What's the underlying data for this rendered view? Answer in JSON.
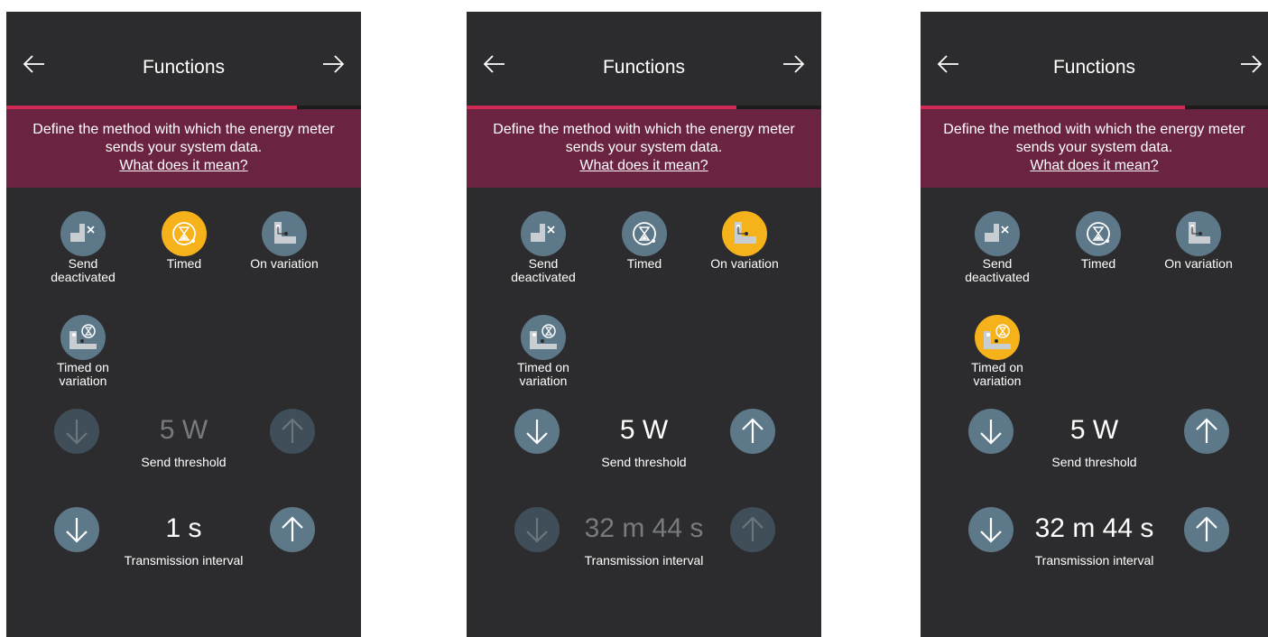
{
  "screens": [
    {
      "title": "Functions",
      "banner_text": "Define the method with which the energy meter sends your system data.",
      "banner_link": "What does it mean?",
      "functions": [
        {
          "label_line1": "Send",
          "label_line2": "deactivated",
          "selected": false,
          "icon": "send-deactivated-icon"
        },
        {
          "label_line1": "Timed",
          "label_line2": "",
          "selected": true,
          "icon": "hourglass-timer-icon"
        },
        {
          "label_line1": "On variation",
          "label_line2": "",
          "selected": false,
          "icon": "variation-step-icon"
        },
        {
          "label_line1": "Timed on",
          "label_line2": "variation",
          "selected": false,
          "icon": "timed-variation-icon"
        }
      ],
      "threshold": {
        "value": "5 W",
        "label": "Send threshold",
        "enabled": false
      },
      "interval": {
        "value": "1 s",
        "label": "Transmission interval",
        "enabled": true
      }
    },
    {
      "title": "Functions",
      "banner_text": "Define the method with which the energy meter sends your system data.",
      "banner_link": "What does it mean?",
      "functions": [
        {
          "label_line1": "Send",
          "label_line2": "deactivated",
          "selected": false,
          "icon": "send-deactivated-icon"
        },
        {
          "label_line1": "Timed",
          "label_line2": "",
          "selected": false,
          "icon": "hourglass-timer-icon"
        },
        {
          "label_line1": "On variation",
          "label_line2": "",
          "selected": true,
          "icon": "variation-step-icon"
        },
        {
          "label_line1": "Timed on",
          "label_line2": "variation",
          "selected": false,
          "icon": "timed-variation-icon"
        }
      ],
      "threshold": {
        "value": "5 W",
        "label": "Send threshold",
        "enabled": true
      },
      "interval": {
        "value": "32 m 44 s",
        "label": "Transmission interval",
        "enabled": false
      }
    },
    {
      "title": "Functions",
      "banner_text": "Define the method with which the energy meter sends your system data.",
      "banner_link": "What does it mean?",
      "functions": [
        {
          "label_line1": "Send",
          "label_line2": "deactivated",
          "selected": false,
          "icon": "send-deactivated-icon"
        },
        {
          "label_line1": "Timed",
          "label_line2": "",
          "selected": false,
          "icon": "hourglass-timer-icon"
        },
        {
          "label_line1": "On variation",
          "label_line2": "",
          "selected": false,
          "icon": "variation-step-icon"
        },
        {
          "label_line1": "Timed on",
          "label_line2": "variation",
          "selected": true,
          "icon": "timed-variation-icon"
        }
      ],
      "threshold": {
        "value": "5 W",
        "label": "Send threshold",
        "enabled": true
      },
      "interval": {
        "value": "32 m 44 s",
        "label": "Transmission interval",
        "enabled": true
      }
    }
  ],
  "colors": {
    "background": "#2c2c2e",
    "banner": "#6a2340",
    "progress": "#d12a55",
    "button": "#5d7888",
    "selected": "#f6b21a"
  }
}
